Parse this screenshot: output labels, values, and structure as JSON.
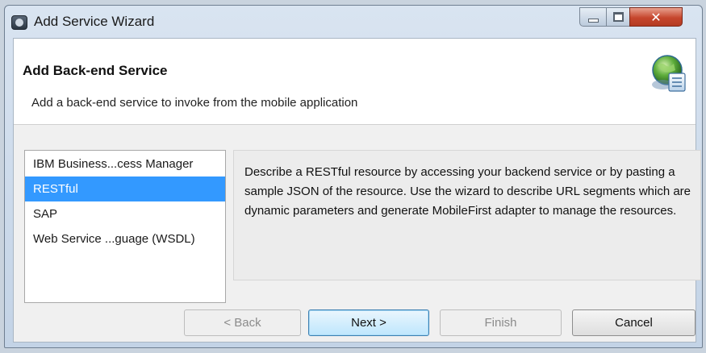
{
  "window": {
    "title": "Add Service Wizard",
    "minimize_icon": "minimize-icon",
    "maximize_icon": "maximize-icon",
    "close_glyph": "✕"
  },
  "header": {
    "title": "Add Back-end Service",
    "description": "Add a back-end service to invoke from the mobile application",
    "icon": "globe-service-icon"
  },
  "service_list": {
    "items": [
      {
        "label": "IBM Business...cess Manager",
        "selected": false
      },
      {
        "label": "RESTful",
        "selected": true
      },
      {
        "label": "SAP",
        "selected": false
      },
      {
        "label": "Web Service ...guage (WSDL)",
        "selected": false
      }
    ]
  },
  "description_panel": {
    "text": "Describe a RESTful resource by accessing your backend service or by pasting a sample JSON of the resource.  Use the wizard to describe URL segments which are dynamic parameters and generate MobileFirst adapter to manage the resources."
  },
  "buttons": {
    "back": {
      "label": "< Back",
      "enabled": false
    },
    "next": {
      "label": "Next >",
      "enabled": true
    },
    "finish": {
      "label": "Finish",
      "enabled": false
    },
    "cancel": {
      "label": "Cancel",
      "enabled": true
    }
  },
  "colors": {
    "selection": "#3399ff",
    "close_button": "#c6462d"
  }
}
